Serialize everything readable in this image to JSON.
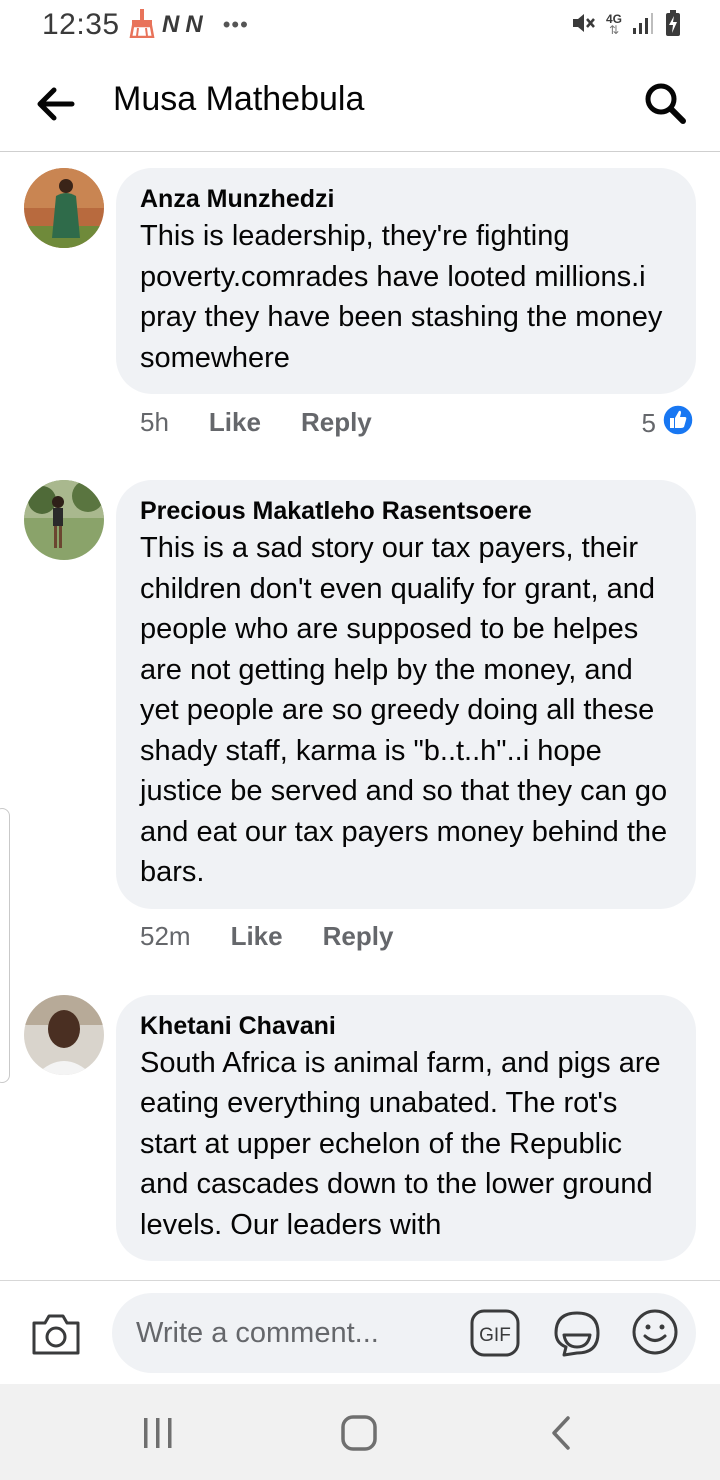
{
  "status_bar": {
    "time": "12:35",
    "network": "4G"
  },
  "header": {
    "title": "Musa Mathebula"
  },
  "comments": [
    {
      "author": "Anza Munzhedzi",
      "text": "This is leadership, they're fighting poverty.comrades  have looted millions.i pray they have been stashing the money somewhere",
      "time": "5h",
      "like_label": "Like",
      "reply_label": "Reply",
      "reaction_count": "5"
    },
    {
      "author": "Precious Makatleho Rasentsoere",
      "text": "This is a sad story our tax payers, their children don't even qualify for grant, and people who are supposed to be helpes are not getting help by the money, and yet people are so greedy doing all these shady staff, karma is \"b..t..h\"..i hope justice be served and so that they can go and eat our tax payers money behind the bars.",
      "time": "52m",
      "like_label": "Like",
      "reply_label": "Reply"
    },
    {
      "author": "Khetani Chavani",
      "text": "South Africa is animal farm, and pigs are eating everything unabated. The rot's start at upper echelon of the Republic and cascades down to the lower ground levels. Our leaders with"
    }
  ],
  "composer": {
    "placeholder": "Write a comment..."
  },
  "colors": {
    "bubble": "#f0f2f5",
    "meta_text": "#65676b",
    "like_blue": "#1877f2",
    "recorder_red": "#e8735a"
  }
}
